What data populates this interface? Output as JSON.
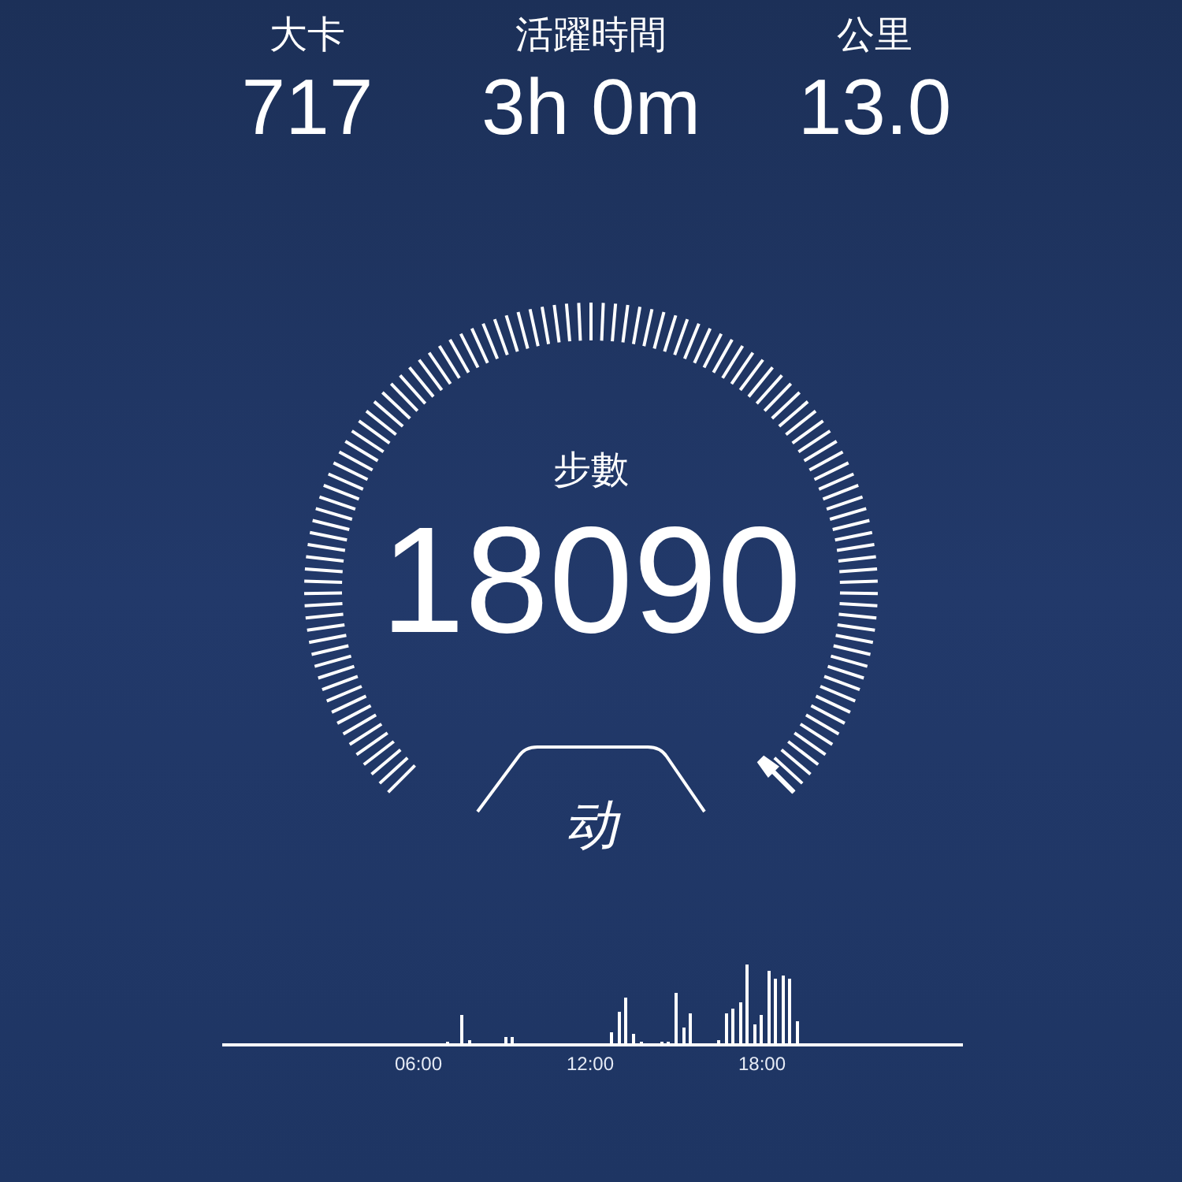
{
  "stats": [
    {
      "label": "大卡",
      "value": "717"
    },
    {
      "label": "活躍時間",
      "value": "3h 0m"
    },
    {
      "label": "公里",
      "value": "13.0"
    }
  ],
  "steps": {
    "label": "步數",
    "value": "18090"
  },
  "logo": {
    "text": "动"
  },
  "activity_chart": {
    "time_labels": [
      "06:00",
      "12:00",
      "18:00"
    ]
  }
}
